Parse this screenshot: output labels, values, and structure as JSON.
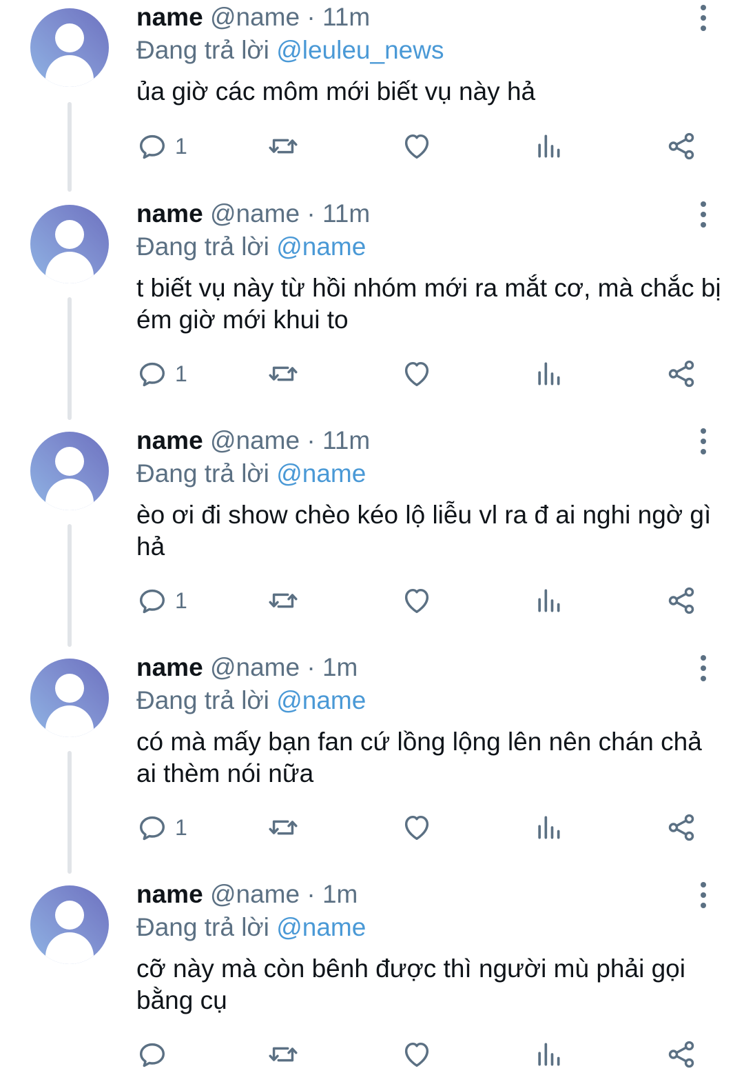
{
  "colors": {
    "accent": "#4a99d6",
    "secondary_text": "#5b7083",
    "primary_text": "#0f1419",
    "thread_line": "#e1e4e8"
  },
  "icons": {
    "more": "vertical-ellipsis-icon",
    "reply": "speech-bubble-icon",
    "retweet": "retweet-arrows-icon",
    "like": "heart-outline-icon",
    "views": "bar-chart-icon",
    "share": "share-nodes-icon"
  },
  "tweets": [
    {
      "name": "name",
      "handle": "@name",
      "sep": "·",
      "time": "11m",
      "reply_prefix": "Đang trả lời",
      "reply_to": "@leuleu_news",
      "text": "ủa giờ các môm mới biết vụ này hả",
      "reply_count": "1"
    },
    {
      "name": "name",
      "handle": "@name",
      "sep": "·",
      "time": "11m",
      "reply_prefix": "Đang trả lời",
      "reply_to": "@name",
      "text": "t biết vụ này từ hồi nhóm mới ra mắt cơ, mà chắc bị ém giờ mới khui to",
      "reply_count": "1"
    },
    {
      "name": "name",
      "handle": "@name",
      "sep": "·",
      "time": "11m",
      "reply_prefix": "Đang trả lời",
      "reply_to": "@name",
      "text": "èo ơi đi show chèo kéo lộ liễu vl ra đ ai nghi ngờ gì hả",
      "reply_count": "1"
    },
    {
      "name": "name",
      "handle": "@name",
      "sep": "·",
      "time": "1m",
      "reply_prefix": "Đang trả lời",
      "reply_to": "@name",
      "text": "có mà mấy bạn fan cứ lồng lộng lên nên chán chả ai thèm nói nữa",
      "reply_count": "1"
    },
    {
      "name": "name",
      "handle": "@name",
      "sep": "·",
      "time": "1m",
      "reply_prefix": "Đang trả lời",
      "reply_to": "@name",
      "text": "cỡ này mà còn bênh được thì người mù phải gọi bằng cụ",
      "reply_count": ""
    }
  ]
}
